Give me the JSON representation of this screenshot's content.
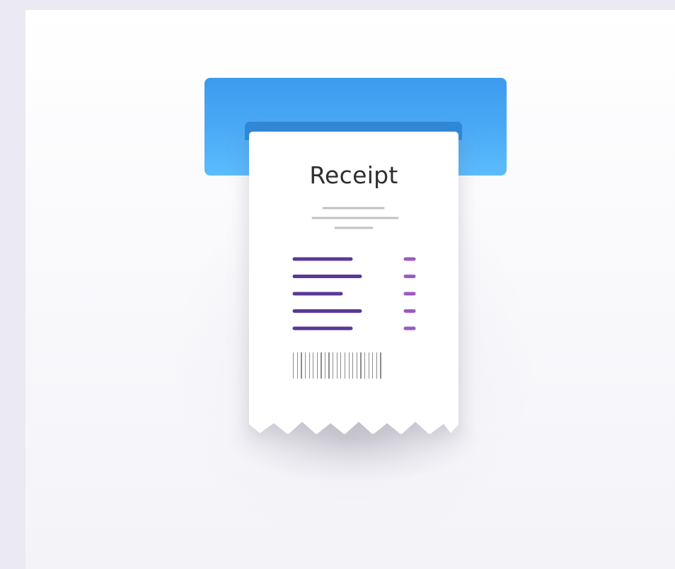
{
  "receipt": {
    "title": "Receipt",
    "item_line_count": 5,
    "header_line_color": "#c2c2c2",
    "item_line_color": "#5b3896",
    "amount_line_color": "#9a5cc0",
    "barcode_color": "#8c8c8c"
  },
  "printer": {
    "top_color": "#3d9bef",
    "bottom_color": "#5bbcfc",
    "slot_color": "#2f88d8"
  },
  "icons": {
    "printer": "printer-icon",
    "receipt": "receipt-icon",
    "barcode": "barcode-icon"
  }
}
